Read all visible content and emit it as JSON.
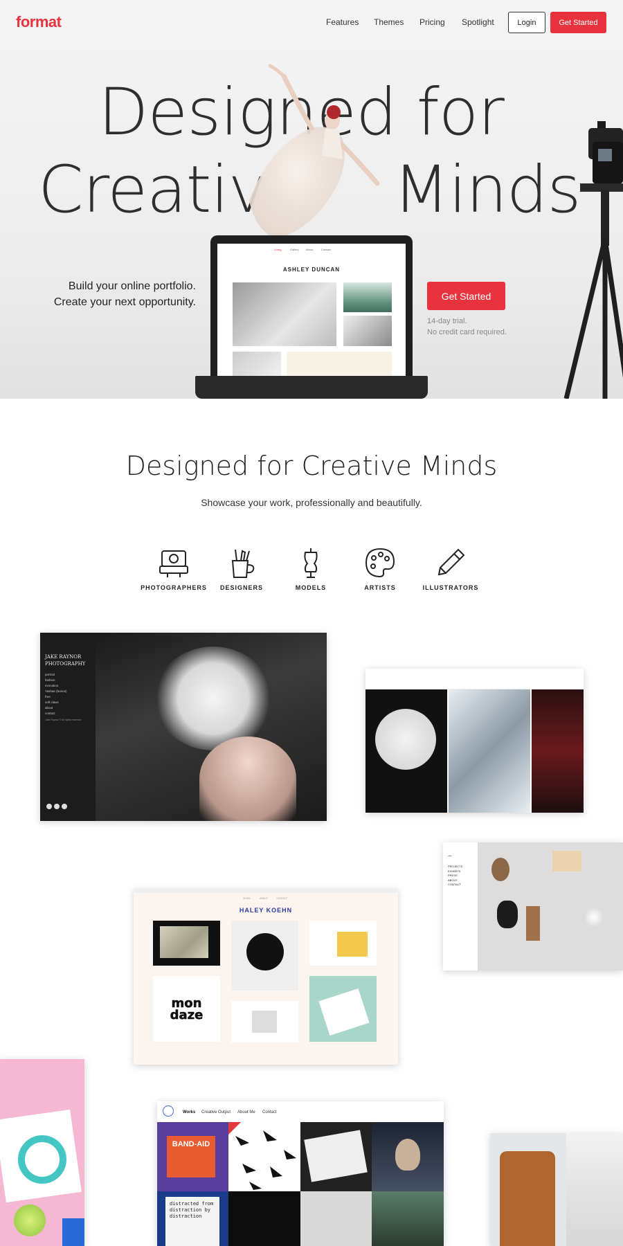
{
  "header": {
    "logo": "format",
    "nav": [
      "Features",
      "Themes",
      "Pricing",
      "Spotlight"
    ],
    "login_label": "Login",
    "get_started_label": "Get Started"
  },
  "hero": {
    "title_line1": "Designed for",
    "title_line2_left": "Creativ",
    "title_line2_right": "Minds",
    "tagline_line1": "Build your online portfolio.",
    "tagline_line2": "Create your next opportunity.",
    "cta_label": "Get Started",
    "trial_line1": "14-day trial.",
    "trial_line2": "No credit card required.",
    "laptop_screen": {
      "nav": [
        "Living",
        "Gallery",
        "About",
        "Contact"
      ],
      "name": "ASHLEY DUNCAN"
    }
  },
  "section": {
    "title": "Designed for Creative Minds",
    "subtitle": "Showcase your work, professionally and beautifully.",
    "categories": [
      {
        "label": "PHOTOGRAPHERS",
        "icon": "camera-icon"
      },
      {
        "label": "DESIGNERS",
        "icon": "design-tools-icon"
      },
      {
        "label": "MODELS",
        "icon": "mannequin-icon"
      },
      {
        "label": "ARTISTS",
        "icon": "palette-icon"
      },
      {
        "label": "ILLUSTRATORS",
        "icon": "pencil-icon"
      }
    ]
  },
  "showcase": {
    "jake": {
      "title_line1": "JAKE RAYNOR",
      "title_line2": "PHOTOGRAPHY",
      "menu": [
        "portrait",
        "fashion",
        "evocation",
        "Yashae (bonus)",
        "free",
        "soft claws",
        "about",
        "contact"
      ],
      "footer": "Jake Raynor © All rights reserved."
    },
    "haley": {
      "name": "HALEY KOEHN",
      "nav": [
        "WORK",
        "ABOUT",
        "CONTACT"
      ],
      "tile_text": "mon daze"
    },
    "studio": {
      "menu": [
        "PROJECTS",
        "EXHIBITS",
        "PRESS",
        "ABOUT",
        "CONTACT"
      ]
    },
    "works": {
      "nav": [
        "Works",
        "Creative Output",
        "About Me",
        "Contact"
      ],
      "tile1": "BAND-AID",
      "tile2": "distracted from distraction by distraction"
    }
  },
  "colors": {
    "accent": "#e8333f"
  }
}
